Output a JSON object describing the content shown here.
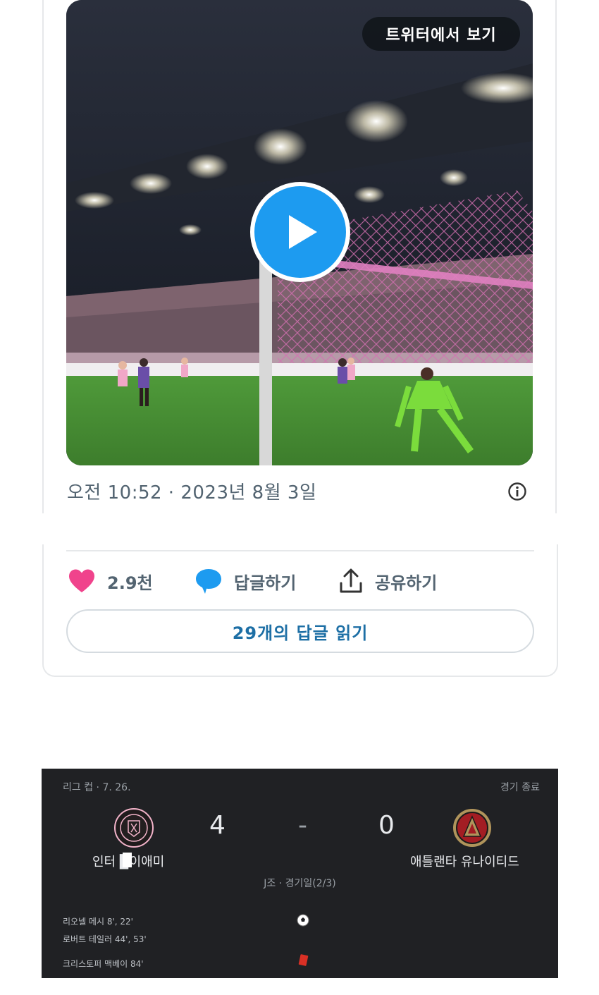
{
  "tweet": {
    "view_on_twitter": "트위터에서 보기",
    "timestamp": "오전 10:52 · 2023년 8월 3일",
    "likes": "2.9천",
    "reply_label": "답글하기",
    "share_label": "공유하기",
    "read_replies": "29개의 답글 읽기",
    "colors": {
      "like": "#f0438c",
      "reply": "#1d9bf0",
      "link": "#1d6fa5"
    },
    "icons": [
      "play-icon",
      "info-icon",
      "heart-icon",
      "speech-bubble-icon",
      "share-upload-icon"
    ]
  },
  "match": {
    "league": "리그 컵 · 7. 26.",
    "status": "경기 종료",
    "home_team": "인터 ▉이애미",
    "away_team": "애틀랜타 유나이티드",
    "home_score": "4",
    "separator": "-",
    "away_score": "0",
    "round": "J조 · 경기일(2/3)",
    "scorers": [
      "리오넬 메시 8', 22'",
      "로버트 테일러 44', 53'"
    ],
    "red_card": "크리스토퍼 맥베이 84'",
    "icons": [
      "inter-miami-crest",
      "atlanta-united-crest",
      "soccer-ball-icon",
      "red-card-icon"
    ]
  }
}
